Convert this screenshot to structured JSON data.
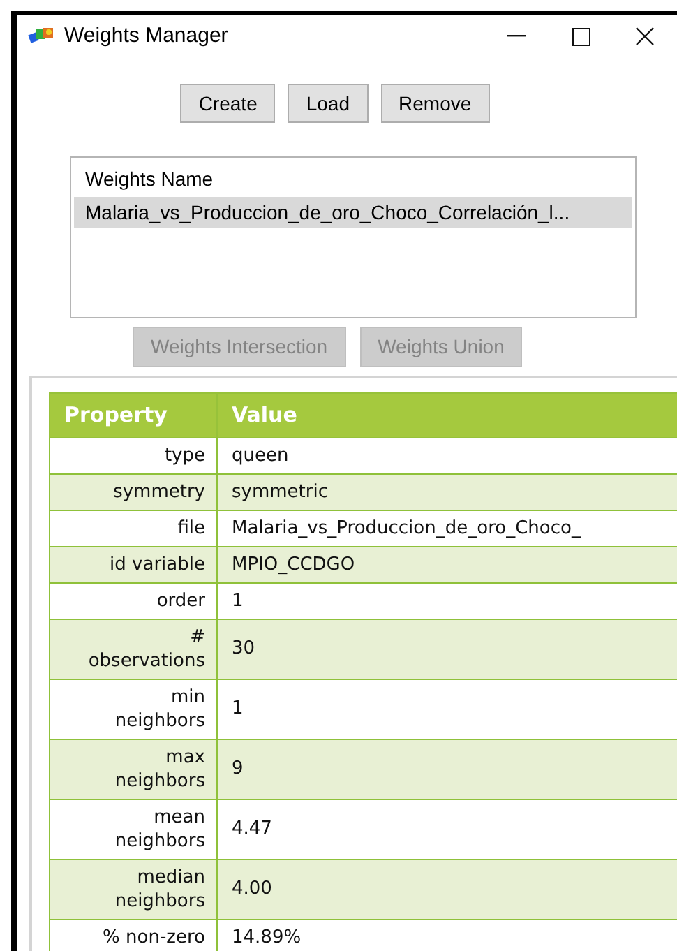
{
  "window": {
    "title": "Weights Manager"
  },
  "buttons": [
    {
      "label": "Create"
    },
    {
      "label": "Load"
    },
    {
      "label": "Remove"
    }
  ],
  "weights_list": {
    "header": "Weights Name",
    "items": [
      {
        "label": "Malaria_vs_Produccion_de_oro_Choco_Correlación_l...",
        "selected": true
      }
    ]
  },
  "set_buttons": [
    {
      "label": "Weights Intersection",
      "disabled": true
    },
    {
      "label": "Weights Union",
      "disabled": true
    }
  ],
  "table": {
    "columns": [
      "Property",
      "Value"
    ],
    "rows": [
      {
        "property": "type",
        "value": "queen"
      },
      {
        "property": "symmetry",
        "value": "symmetric"
      },
      {
        "property": "file",
        "value": "Malaria_vs_Produccion_de_oro_Choco_"
      },
      {
        "property": "id variable",
        "value": "MPIO_CCDGO"
      },
      {
        "property": "order",
        "value": "1"
      },
      {
        "property": "#\nobservations",
        "value": "30"
      },
      {
        "property": "min\nneighbors",
        "value": "1"
      },
      {
        "property": "max\nneighbors",
        "value": "9"
      },
      {
        "property": "mean\nneighbors",
        "value": "4.47"
      },
      {
        "property": "median\nneighbors",
        "value": "4.00"
      },
      {
        "property": "% non-zero",
        "value": "14.89%"
      }
    ]
  }
}
